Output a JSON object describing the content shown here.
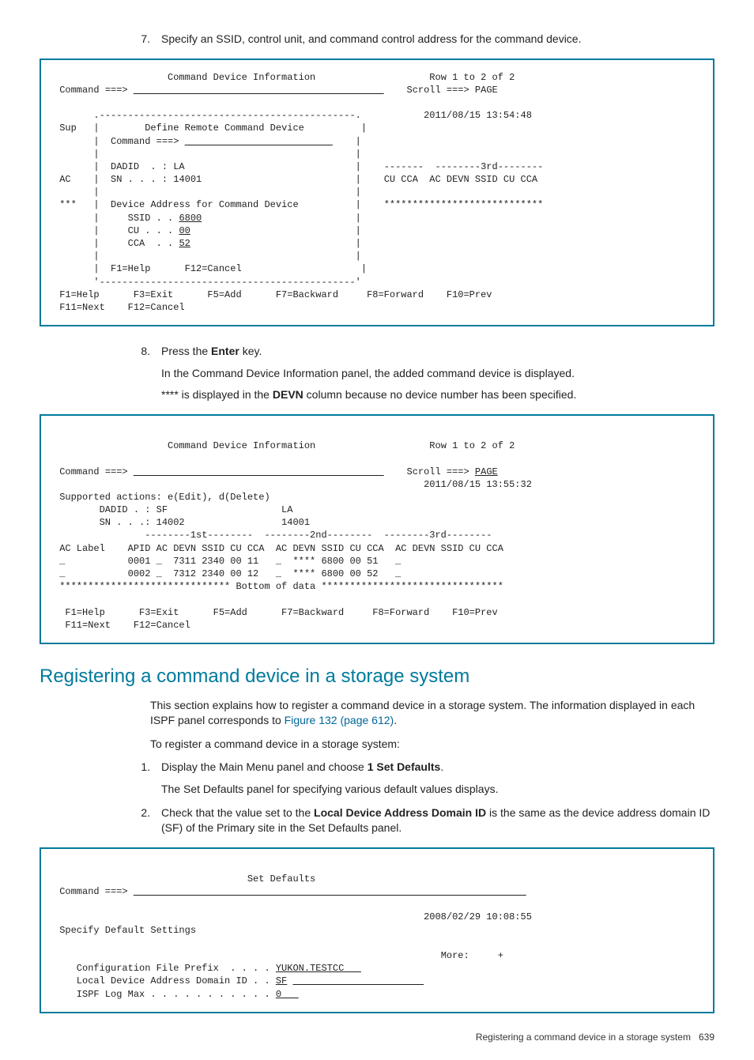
{
  "step7": {
    "num": "7.",
    "text": "Specify an SSID, control unit, and command control address for the command device."
  },
  "panel1": {
    "title": "Command Device Information",
    "row_info": "Row 1 to 2 of 2",
    "command_label": "Command ===>",
    "scroll_label": "Scroll ===> PAGE",
    "timestamp": "2011/08/15 13:54:48",
    "sup": "Sup",
    "popup_title": "Define Remote Command Device",
    "popup_command": "Command ===>",
    "dadid_label": "DADID  . : LA",
    "ac": "AC",
    "sn_label": "SN . . . : 14001",
    "third_header": "-------  --------3rd--------",
    "third_cols": "CU CCA  AC DEVN SSID CU CCA",
    "stars": "***",
    "dev_addr_title": "Device Address for Command Device",
    "stars_right": "****************************",
    "ssid": "SSID . .",
    "ssid_val": "6800",
    "cu": "CU . . .",
    "cu_val": "00",
    "cca": "CCA  . .",
    "cca_val": "52",
    "popup_keys": "F1=Help      F12=Cancel",
    "keys1": " F1=Help      F3=Exit      F5=Add      F7=Backward     F8=Forward    F10=Prev",
    "keys2": " F11=Next    F12=Cancel"
  },
  "step8": {
    "num": "8.",
    "line1_a": "Press the ",
    "line1_b": "Enter",
    "line1_c": " key.",
    "line2": "In the Command Device Information panel, the added command device is displayed.",
    "line3_a": "**** is displayed in the ",
    "line3_b": "DEVN",
    "line3_c": " column because no device number has been specified."
  },
  "panel2": {
    "title": "Command Device Information",
    "row_info": "Row 1 to 2 of 2",
    "command_label": "Command ===>",
    "scroll_label": "Scroll ===> ",
    "scroll_val": "PAGE",
    "timestamp": "2011/08/15 13:55:32",
    "supported": " Supported actions: e(Edit), d(Delete)",
    "dadid_line": "        DADID . : SF                    LA",
    "sn_line": "        SN . . .: 14002                 14001",
    "headers": "                --------1st--------  --------2nd--------  --------3rd--------",
    "cols": " AC Label    APID AC DEVN SSID CU CCA  AC DEVN SSID CU CCA  AC DEVN SSID CU CCA",
    "row1": " _           0001 _  7311 2340 00 11   _  **** 6800 00 51   _",
    "row2": " _           0002 _  7312 2340 00 12   _  **** 6800 00 52   _",
    "bottom": " ****************************** Bottom of data ********************************",
    "keys1": "  F1=Help      F3=Exit      F5=Add      F7=Backward     F8=Forward    F10=Prev",
    "keys2": "  F11=Next    F12=Cancel"
  },
  "heading": "Registering a command device in a storage system",
  "intro1_a": "This section explains how to register a command device in a storage system. The information displayed in each ISPF panel corresponds to ",
  "intro1_link": "Figure 132 (page 612)",
  "intro1_b": ".",
  "intro2": "To register a command device in a storage system:",
  "reg_step1": {
    "num": "1.",
    "a": "Display the Main Menu panel and choose ",
    "b": "1 Set Defaults",
    "c": ".",
    "d": "The Set Defaults panel for specifying various default values displays."
  },
  "reg_step2": {
    "num": "2.",
    "a": "Check that the value set to the ",
    "b": "Local Device Address Domain ID",
    "c": " is the same as the device address domain ID (SF) of the Primary site in the Set Defaults panel."
  },
  "panel3": {
    "title": "Set Defaults",
    "command_label": " Command ===>",
    "timestamp": "2008/02/29 10:08:55",
    "specify": " Specify Default Settings",
    "more": "More:     +",
    "cfg_prefix_label": "    Configuration File Prefix  . . . .",
    "cfg_prefix_val": "YUKON.TESTCC",
    "ldadid_label": "    Local Device Address Domain ID . .",
    "ldadid_val": "SF",
    "ispf_label": "    ISPF Log Max . . . . . . . . . . .",
    "ispf_val": "0"
  },
  "footer_a": "Registering a command device in a storage system",
  "footer_b": "639"
}
